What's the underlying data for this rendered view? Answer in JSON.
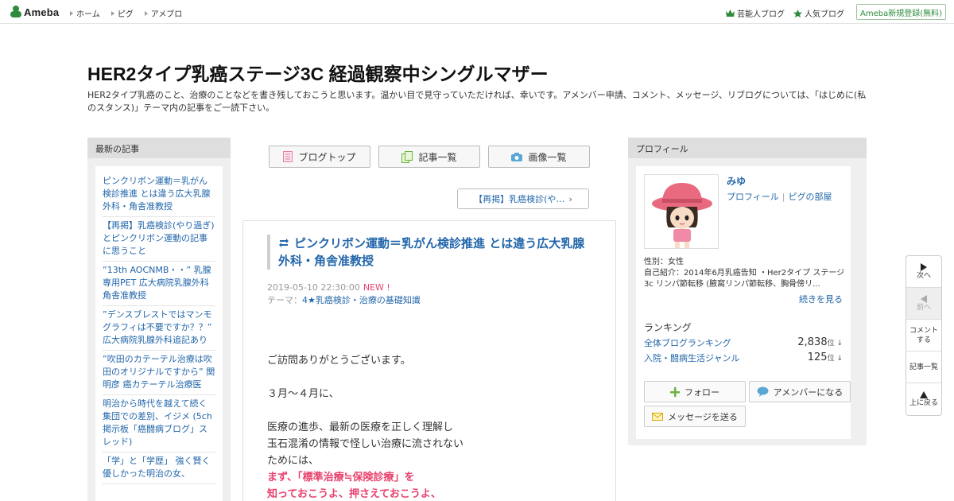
{
  "header": {
    "logo_text": "Ameba",
    "nav": [
      "ホーム",
      "ピグ",
      "アメブロ"
    ],
    "links": [
      "芸能人ブログ",
      "人気ブログ"
    ],
    "register": "Ameba新規登録(無料)"
  },
  "blog": {
    "title": "HER2タイプ乳癌ステージ3C 経過観察中シングルマザー",
    "description": "HER2タイプ乳癌のこと、治療のことなどを書き残しておこうと思います。温かい目で見守っていただければ、幸いです。アメンバー申請、コメント、メッセージ、リブログについては、「はじめに(私のスタンス)」テーマ内の記事をご一読下さい。"
  },
  "recent": {
    "heading": "最新の記事",
    "items": [
      "ピンクリボン運動＝乳がん検診推進 とは違う広大乳腺外科・角舎准教授",
      "【再掲】乳癌検診(やり過ぎ)とピンクリボン運動の記事に思うこと",
      "”13th AOCNMB・・” 乳腺専用PET 広大病院乳腺外科 角舎准教授",
      "”デンスブレストではマンモグラフィは不要ですか？？” 広大病院乳腺外科追記あり",
      "”吹田のカテーテル治療は吹田のオリジナルですから” 関明彦 癌カテーテル治療医",
      "明治から時代を越えて続く 集団での差別、イジメ (5ch掲示板「癌闘病ブログ」スレッド)",
      "「学」と「学歴」 強く賢く優しかった明治の女、"
    ]
  },
  "blog_nav": {
    "top": "ブログトップ",
    "list": "記事一覧",
    "images": "画像一覧",
    "prev": "【再掲】乳癌検診(や…"
  },
  "article": {
    "title": "ピンクリボン運動＝乳がん検診推進 とは違う広大乳腺外科・角舎准教授",
    "date": "2019-05-10 22:30:00",
    "new_label": "NEW !",
    "theme_label": "テーマ：",
    "theme": "4★乳癌検診・治療の基礎知識",
    "body": [
      "ご訪問ありがとうございます。",
      "",
      "３月～４月に、",
      "",
      "医療の進歩、最新の医療を正しく理解し",
      "玉石混淆の情報で怪しい治療に流されない",
      "ためには、"
    ],
    "emphasis": [
      "まず、「標準治療≒保険診療」を",
      "知っておこうよ、押さえておこうよ、"
    ]
  },
  "profile": {
    "heading": "プロフィール",
    "name": "みゆ",
    "link_profile": "プロフィール",
    "link_pig": "ピグの部屋",
    "gender": "性別：女性",
    "intro": "自己紹介：2014年6月乳癌告知 ・Her2タイプ ステージ3c リンパ節転移 (腋窩リンパ節転移、胸骨傍リ...",
    "see_more": "続きを見る",
    "ranking_title": "ランキング",
    "rankings": [
      {
        "label": "全体ブログランキング",
        "value": "2,838",
        "unit": "位 ↓"
      },
      {
        "label": "入院・闘病生活ジャンル",
        "value": "125",
        "unit": "位 ↓"
      }
    ],
    "follow": "フォロー",
    "amember": "アメンバーになる",
    "message": "メッセージを送る"
  },
  "side_tools": {
    "next": "次へ",
    "prev": "前へ",
    "comment": "コメントする",
    "list": "記事一覧",
    "top": "上に戻る"
  },
  "colors": {
    "ameba_green": "#2d8c3c",
    "link_blue": "#2266aa",
    "new_pink": "#e8426d"
  }
}
